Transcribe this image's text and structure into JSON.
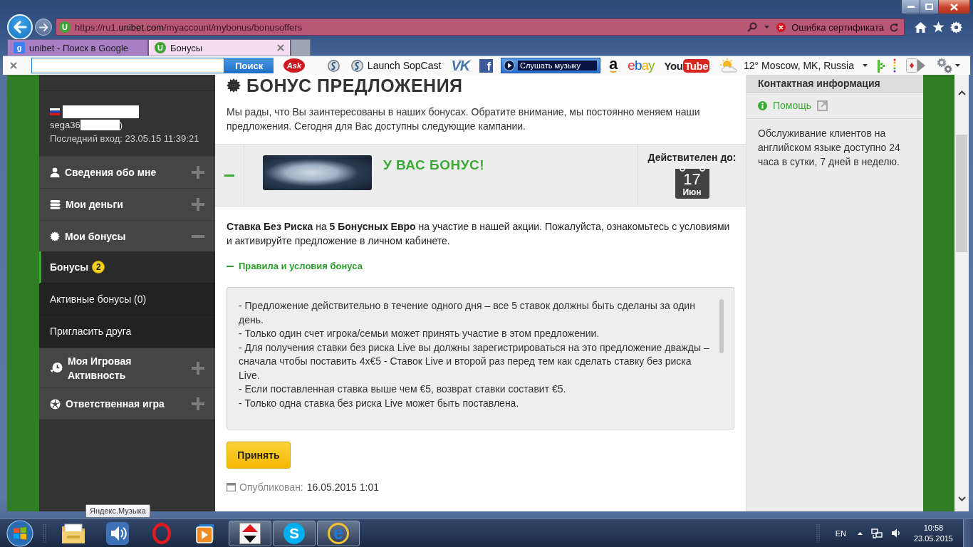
{
  "browser": {
    "favicon_letter": "U",
    "url_prefix": "https://ru1.",
    "url_domain": "unibet.com",
    "url_path": "/myaccount/mybonus/bonusoffers",
    "certificate_status": "Ошибка сертификата"
  },
  "tabs": [
    {
      "kind": "search",
      "icon_letter": "g",
      "label": "unibet - Поиск в Google",
      "selected": false
    },
    {
      "kind": "site",
      "icon_letter": "U",
      "label": "Бонусы",
      "selected": true
    }
  ],
  "toolbar": {
    "search_button": "Поиск",
    "items": [
      {
        "kind": "ask",
        "label": "Ask"
      },
      {
        "kind": "sopcast"
      },
      {
        "kind": "sopcast",
        "label": "Launch SopCast"
      },
      {
        "kind": "vk",
        "label": "VK"
      },
      {
        "kind": "facebook",
        "label": "f"
      },
      {
        "kind": "music",
        "label": "Слушать музыку"
      },
      {
        "kind": "amazon",
        "label": "a"
      },
      {
        "kind": "ebay",
        "label": "ebay"
      },
      {
        "kind": "youtube",
        "label": "You",
        "label_boxed": "Tube"
      },
      {
        "kind": "weather",
        "label": "12° Moscow, MK, Russia"
      },
      {
        "kind": "equalizer"
      },
      {
        "kind": "dots"
      },
      {
        "kind": "cards"
      }
    ]
  },
  "sidebar": {
    "user": {
      "login": "sega36",
      "login_end": ")",
      "last_login": "Последний вход: 23.05.15 11:39:21"
    },
    "menu": [
      {
        "kind": "person",
        "label": "Сведения обо мне",
        "expanded": false
      },
      {
        "kind": "coins",
        "label": "Мои деньги",
        "expanded": false
      },
      {
        "kind": "badge",
        "label": "Мои бонусы",
        "expanded": true,
        "children": [
          {
            "label": "Бонусы",
            "badge": "2",
            "selected": true
          },
          {
            "label": "Активные бонусы (0)",
            "selected": false
          },
          {
            "label": "Пригласить друга",
            "selected": false
          }
        ]
      },
      {
        "kind": "clock",
        "label": "Моя Игровая Активность",
        "expanded": false
      },
      {
        "kind": "ball",
        "label": "Ответственная игра",
        "expanded": false
      }
    ]
  },
  "main": {
    "title": "БОНУС ПРЕДЛОЖЕНИЯ",
    "intro": "Мы рады, что Вы заинтересованы в наших бонусах. Обратите внимание, мы постоянно меняем наши предложения. Сегодня для Вас доступны следующие кампании.",
    "offer": {
      "expanded": true,
      "headline": "У ВАС БОНУС!",
      "valid_label": "Действителен до:",
      "valid_day": "17",
      "valid_month": "Июн",
      "description": "**Ставка Без Риска** на **5 Бонусных Евро** на участие в нашей акции. Пожалуйста, ознакомьтесь с условиями и активируйте предложение в личном кабинете.",
      "terms_toggle": "Правила и условия бонуса",
      "terms_expanded": true,
      "terms": [
        "- Предложение действительно в течение одного дня – все 5 ставок должны быть сделаны за один день.",
        "- Только один счет игрока/семьи может принять участие в этом предложении.",
        "- Для получения ставки без риска Live вы должны зарегистрироваться на это предложение дважды – сначала чтобы поставить 4x€5 - Ставок Live и второй раз перед тем как сделать ставку без риска Live.",
        "- Если поставленная ставка выше чем €5, возврат ставки составит €5.",
        "- Только одна ставка без риска Live может быть поставлена."
      ],
      "accept_button": "Принять",
      "published_label": "Опубликован:",
      "published_date": "16.05.2015 1:01"
    }
  },
  "contact": {
    "title": "Контактная информация",
    "help_link": "Помощь",
    "note": "Обслуживание клиентов на английском языке доступно 24 часа в сутки, 7 дней в неделю."
  },
  "taskbar": {
    "apps": [
      {
        "kind": "explorer",
        "running": false
      },
      {
        "kind": "speaker",
        "running": false
      },
      {
        "kind": "opera",
        "running": false
      },
      {
        "kind": "media",
        "running": false
      },
      {
        "kind": "updown",
        "running": true
      },
      {
        "kind": "skype",
        "label": "S",
        "running": true
      },
      {
        "kind": "ie",
        "label": "e",
        "running": true
      }
    ],
    "tooltip": "Яндекс.Музыка",
    "language": "EN",
    "time": "10:58",
    "date": "23.05.2015"
  }
}
